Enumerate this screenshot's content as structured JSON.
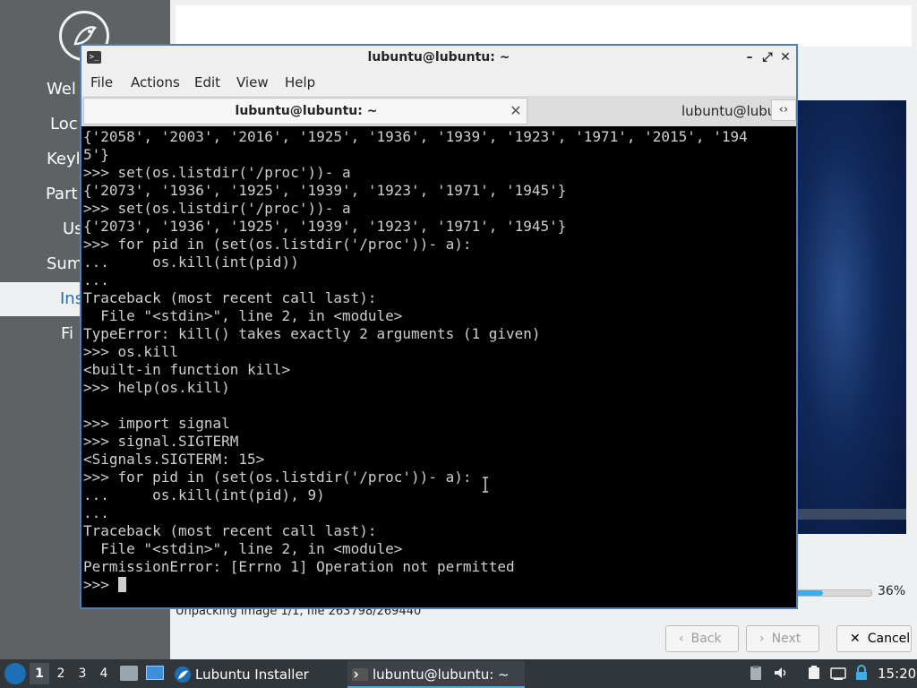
{
  "installer": {
    "steps": [
      {
        "label": "Wel"
      },
      {
        "label": "Loc"
      },
      {
        "label": "Keyl"
      },
      {
        "label": "Part"
      },
      {
        "label": "Us"
      },
      {
        "label": "Sum"
      },
      {
        "label": "Ins",
        "active": true
      },
      {
        "label": "Fi"
      }
    ],
    "progress": {
      "value_percent": 36,
      "label": "36%"
    },
    "status_text": "Unpacking image 1/1, file 263798/269440",
    "buttons": {
      "back": "Back",
      "next": "Next",
      "cancel": "Cancel"
    }
  },
  "terminal": {
    "window_title": "lubuntu@lubuntu: ~",
    "menu": [
      "File",
      "Actions",
      "Edit",
      "View",
      "Help"
    ],
    "tabs": [
      {
        "label": "lubuntu@lubuntu: ~",
        "active": true
      },
      {
        "label": "lubuntu@lubu",
        "active": false
      }
    ],
    "lines": [
      "{'2058', '2003', '2016', '1925', '1936', '1939', '1923', '1971', '2015', '194",
      "5'}",
      ">>> set(os.listdir('/proc'))- a",
      "{'2073', '1936', '1925', '1939', '1923', '1971', '1945'}",
      ">>> set(os.listdir('/proc'))- a",
      "{'2073', '1936', '1925', '1939', '1923', '1971', '1945'}",
      ">>> for pid in (set(os.listdir('/proc'))- a):",
      "...     os.kill(int(pid))",
      "...",
      "Traceback (most recent call last):",
      "  File \"<stdin>\", line 2, in <module>",
      "TypeError: kill() takes exactly 2 arguments (1 given)",
      ">>> os.kill",
      "<built-in function kill>",
      ">>> help(os.kill)",
      "",
      ">>> import signal",
      ">>> signal.SIGTERM",
      "<Signals.SIGTERM: 15>",
      ">>> for pid in (set(os.listdir('/proc'))- a):",
      "...     os.kill(int(pid), 9)",
      "...",
      "Traceback (most recent call last):",
      "  File \"<stdin>\", line 2, in <module>",
      "PermissionError: [Errno 1] Operation not permitted"
    ],
    "prompt": ">>> "
  },
  "taskbar": {
    "workspaces": [
      "1",
      "2",
      "3",
      "4"
    ],
    "tasks": [
      {
        "label": "Lubuntu Installer",
        "active": false
      },
      {
        "label": "lubuntu@lubuntu: ~",
        "active": true
      }
    ],
    "clock": "15:20"
  },
  "colors": {
    "accent": "#3daee9",
    "installer_active": "#1d6fb5",
    "terminal_border": "#4a7ec4"
  },
  "icons": {
    "start": "lubuntu-logo-icon",
    "terminal": "terminal-icon",
    "tray": [
      "clipboard-icon",
      "volume-icon",
      "battery-icon",
      "network-icon",
      "lock-icon"
    ]
  }
}
